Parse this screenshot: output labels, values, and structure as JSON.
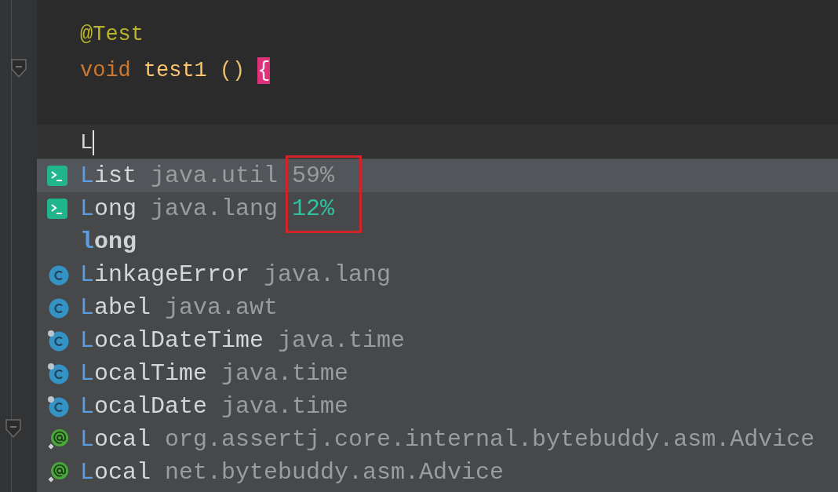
{
  "editor": {
    "lines": [
      {
        "tokens": [
          {
            "kind": "annotation",
            "text": "@Test"
          }
        ]
      },
      {
        "tokens": [
          {
            "kind": "keyword",
            "text": "void"
          },
          {
            "kind": "method",
            "text": "test1"
          },
          {
            "kind": "paren",
            "text": "()"
          },
          {
            "kind": "brace",
            "text": "{"
          }
        ]
      }
    ],
    "current_line": {
      "text": "L"
    }
  },
  "completion": {
    "items": [
      {
        "kind": "template",
        "name": "List",
        "package": "java.util",
        "score": {
          "text": "59%",
          "color": "#9a9a9a"
        },
        "selected": true
      },
      {
        "kind": "template",
        "name": "Long",
        "package": "java.lang",
        "score": {
          "text": "12%",
          "color": "#2fc3a0"
        },
        "selected": false
      },
      {
        "kind": "keyword",
        "name": "long",
        "selected": false
      },
      {
        "kind": "class",
        "name": "LinkageError",
        "package": "java.lang",
        "selected": false
      },
      {
        "kind": "class",
        "name": "Label",
        "package": "java.awt",
        "selected": false
      },
      {
        "kind": "class-badged",
        "name": "LocalDateTime",
        "package": "java.time",
        "selected": false
      },
      {
        "kind": "class-badged",
        "name": "LocalTime",
        "package": "java.time",
        "selected": false
      },
      {
        "kind": "class-badged",
        "name": "LocalDate",
        "package": "java.time",
        "selected": false
      },
      {
        "kind": "annotation",
        "name": "Local",
        "package": "org.assertj.core.internal.bytebuddy.asm.Advice",
        "selected": false
      },
      {
        "kind": "annotation",
        "name": "Local",
        "package": "net.bytebuddy.asm.Advice",
        "selected": false
      }
    ],
    "annotation_box": {
      "color": "#d0242a"
    }
  }
}
